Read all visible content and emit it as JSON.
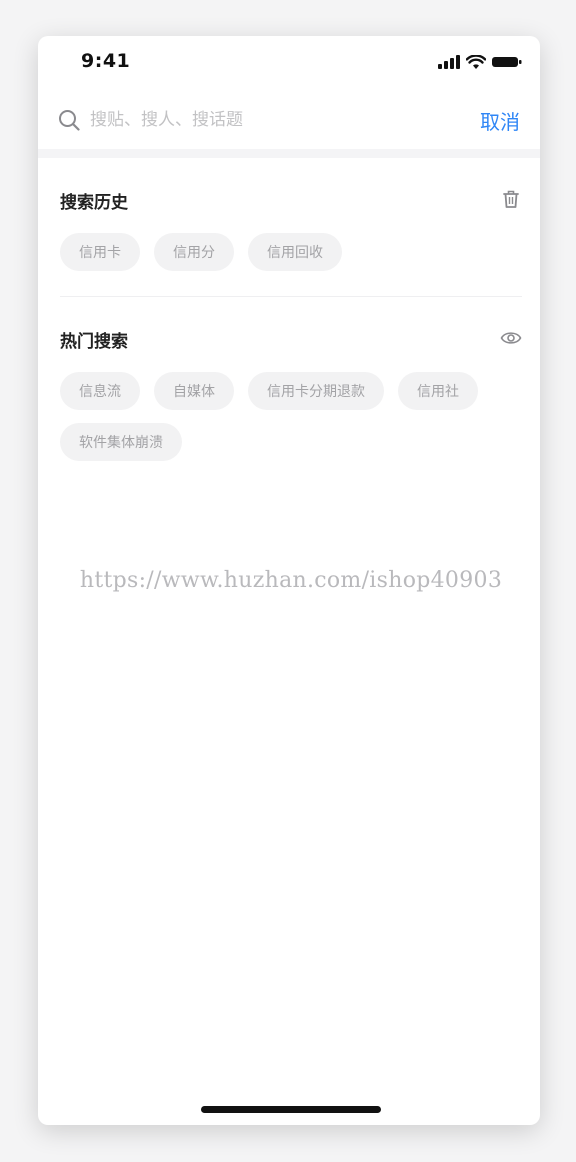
{
  "status_bar": {
    "time": "9:41",
    "icons": [
      "cellular-signal-icon",
      "wifi-icon",
      "battery-icon"
    ]
  },
  "search": {
    "placeholder": "搜贴、搜人、搜话题",
    "value": "",
    "icon": "search-icon",
    "cancel_label": "取消",
    "accent_color": "#2f86f6"
  },
  "history": {
    "title": "搜索历史",
    "action_icon": "trash-icon",
    "items": [
      "信用卡",
      "信用分",
      "信用回收"
    ]
  },
  "hot": {
    "title": "热门搜索",
    "action_icon": "eye-icon",
    "items": [
      "信息流",
      "自媒体",
      "信用卡分期退款",
      "信用社",
      "软件集体崩溃"
    ]
  },
  "watermark": "https://www.huzhan.com/ishop40903"
}
